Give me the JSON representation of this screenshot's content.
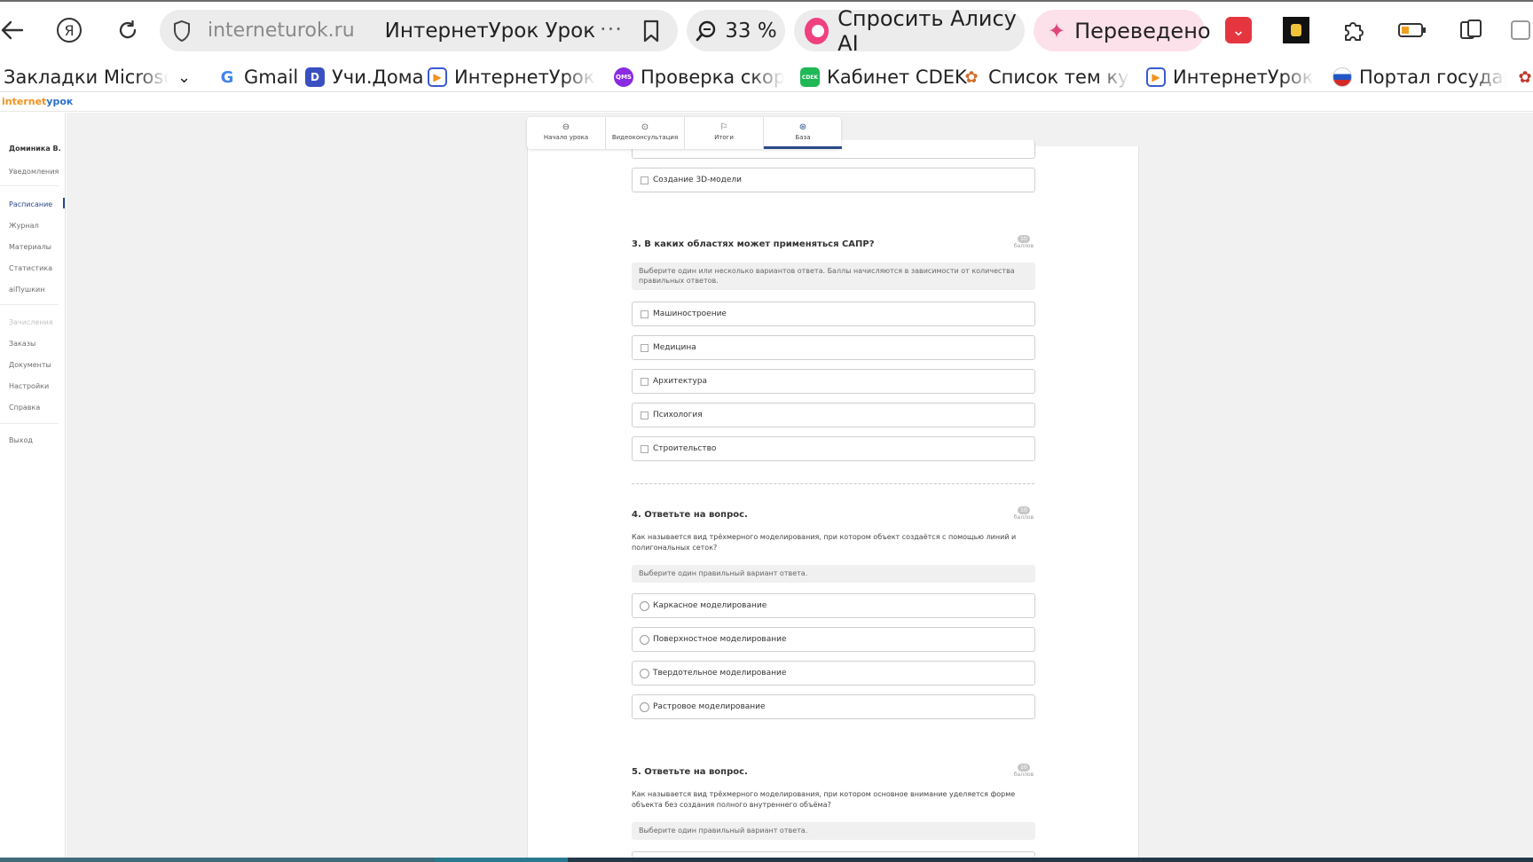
{
  "browser": {
    "address_site": "interneturok.ru",
    "tab_title": "ИнтернетУрок Урок",
    "more": "···",
    "zoom": "33 %",
    "alice": "Спросить Алису AI",
    "translate": "Переведено",
    "ya_glyph": "Я"
  },
  "bookmarks": [
    {
      "label": "Закладки Microsoft E",
      "chevron": "⌄"
    },
    {
      "label": "Gmail",
      "fav_text": "G"
    },
    {
      "label": "Учи.Дома",
      "fav_text": "D"
    },
    {
      "label": "ИнтернетУрок Ра",
      "fav_text": "▶"
    },
    {
      "label": "Проверка скорос",
      "fav_text": "QMS"
    },
    {
      "label": "Кабинет CDEK",
      "fav_text": "CDEK"
    },
    {
      "label": "Список тем курса",
      "fav_text": "✿"
    },
    {
      "label": "ИнтернетУрок Ра",
      "fav_text": "▶"
    },
    {
      "label": "Портал государст",
      "fav_text": ""
    }
  ],
  "logo": {
    "part1": "internet",
    "part2": "урок"
  },
  "sidebar": {
    "user": "Доминика В.",
    "notifications": "Уведомления",
    "items": [
      "Расписание",
      "Журнал",
      "Материалы",
      "Статистика",
      "aiПушкин"
    ],
    "section": "Зачисления",
    "items2": [
      "Заказы",
      "Документы",
      "Настройки",
      "Справка"
    ],
    "logout": "Выход"
  },
  "steps": [
    {
      "label": "Начало урока",
      "icon": "⊖"
    },
    {
      "label": "Видеоконсультация",
      "icon": "⊙"
    },
    {
      "label": "Итоги",
      "icon": "⚐"
    },
    {
      "label": "База",
      "icon": "⊛"
    }
  ],
  "q2": {
    "last_option": "Создание 3D-модели"
  },
  "q3": {
    "title": "3. В каких областях может применяться САПР?",
    "score": "10",
    "score_label": "баллов",
    "hint": "Выберите один или несколько вариантов ответа. Баллы начисляются в зависимости от количества правильных ответов.",
    "options": [
      "Машиностроение",
      "Медицина",
      "Архитектура",
      "Психология",
      "Строительство"
    ]
  },
  "q4": {
    "title": "4. Ответьте на вопрос.",
    "score": "10",
    "score_label": "баллов",
    "text": "Как называется вид трёхмерного моделирования, при котором объект создаётся с помощью линий и полигональных сеток?",
    "hint": "Выберите один правильный вариант ответа.",
    "options": [
      "Каркасное моделирование",
      "Поверхностное моделирование",
      "Твердотельное моделирование",
      "Растровое моделирование"
    ]
  },
  "q5": {
    "title": "5. Ответьте на вопрос.",
    "score": "10",
    "score_label": "баллов",
    "text": "Как называется вид трёхмерного моделирования, при котором основное внимание уделяется форме объекта без создания полного внутреннего объёма?",
    "hint": "Выберите один правильный вариант ответа."
  },
  "colors": {
    "accent": "#2a4a8a",
    "alice": "#f04080",
    "translate_bg": "#fde1ea",
    "logo_orange": "#f0921e",
    "logo_blue": "#2b6fcf"
  }
}
